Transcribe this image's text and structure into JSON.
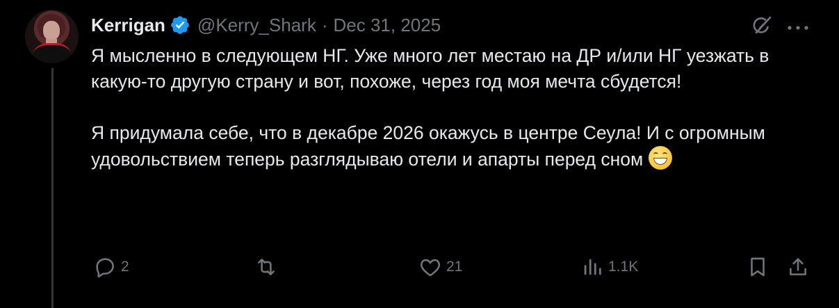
{
  "author": {
    "name": "Kerrigan",
    "handle": "@Kerry_Shark",
    "separator": "·",
    "date": "Dec 31, 2025",
    "verified": true
  },
  "tweet": {
    "paragraph1": "Я мысленно в следующем НГ. Уже много лет местаю на ДР и/или НГ уезжать в какую-то другую страну и вот, похоже, через год моя мечта сбудется!",
    "paragraph2": "Я придумала себе, что в декабре 2026 окажусь в центре Сеула! И с огромным удовольствием теперь разглядываю отели и апарты перед сном",
    "emoji": "grinning-face-with-smiling-eyes"
  },
  "actions": {
    "replies": "2",
    "reposts": "",
    "likes": "21",
    "views": "1.1K"
  },
  "icons": {
    "verified": "verified-badge-icon",
    "grok": "grok-icon",
    "more": "more-options-icon",
    "reply": "reply-icon",
    "repost": "repost-icon",
    "like": "like-icon",
    "views": "views-icon",
    "bookmark": "bookmark-icon",
    "share": "share-icon"
  },
  "colors": {
    "background": "#000000",
    "text": "#e7e9ea",
    "muted": "#71767b",
    "verified": "#1d9bf0"
  }
}
